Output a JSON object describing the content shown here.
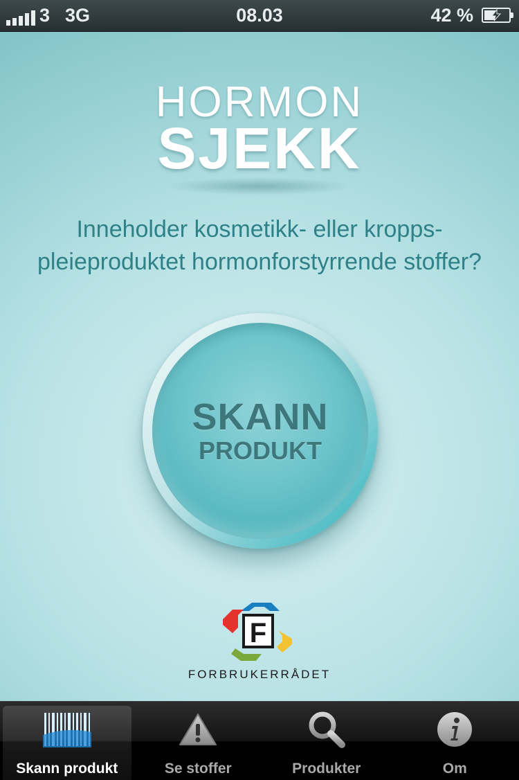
{
  "status_bar": {
    "carrier": "3",
    "network": "3G",
    "time": "08.03",
    "battery": "42 %"
  },
  "logo": {
    "line1": "HORMON",
    "line2": "SJEKK"
  },
  "question": {
    "line1": "Inneholder kosmetikk- eller kropps-",
    "line2": "pleieproduktet hormonforstyrrende stoffer?"
  },
  "scan_button": {
    "line1": "SKANN",
    "line2": "PRODUKT"
  },
  "footer": {
    "brand": "FORBRUKERRÅDET",
    "logo_letter": "F"
  },
  "tabs": [
    {
      "label": "Skann produkt",
      "icon": "barcode-icon",
      "active": true
    },
    {
      "label": "Se stoffer",
      "icon": "warning-icon",
      "active": false
    },
    {
      "label": "Produkter",
      "icon": "search-icon",
      "active": false
    },
    {
      "label": "Om",
      "icon": "info-icon",
      "active": false
    }
  ],
  "colors": {
    "accent": "#2e8187",
    "button": "#4db2ba",
    "tabbar": "#141414"
  }
}
